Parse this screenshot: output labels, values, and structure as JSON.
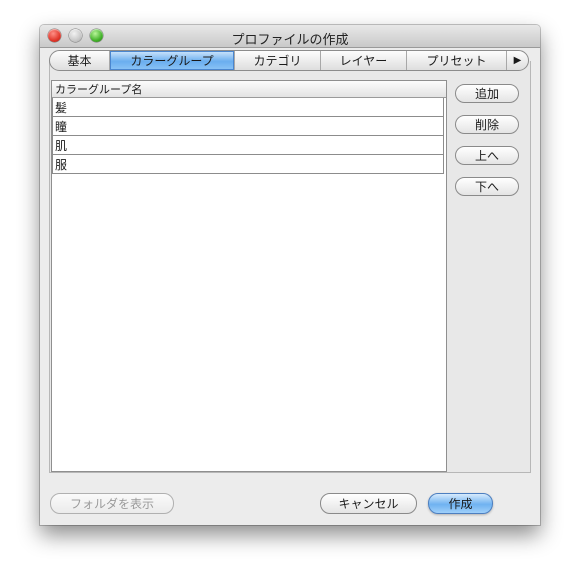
{
  "window": {
    "title": "プロファイルの作成"
  },
  "tabs": [
    {
      "label": "基本",
      "active": false
    },
    {
      "label": "カラーグループ",
      "active": true
    },
    {
      "label": "カテゴリ",
      "active": false
    },
    {
      "label": "レイヤー",
      "active": false
    },
    {
      "label": "プリセット",
      "active": false
    }
  ],
  "tab_overflow_arrow": "▶",
  "table": {
    "header": "カラーグループ名",
    "rows": [
      "髪",
      "瞳",
      "肌",
      "服"
    ]
  },
  "side_buttons": {
    "add": "追加",
    "delete": "削除",
    "up": "上へ",
    "down": "下へ"
  },
  "footer": {
    "show_folder": "フォルダを表示",
    "cancel": "キャンセル",
    "create": "作成"
  },
  "colors": {
    "accent_blue": "#6aaeef",
    "close": "#e0372b",
    "zoom": "#43b22a"
  }
}
